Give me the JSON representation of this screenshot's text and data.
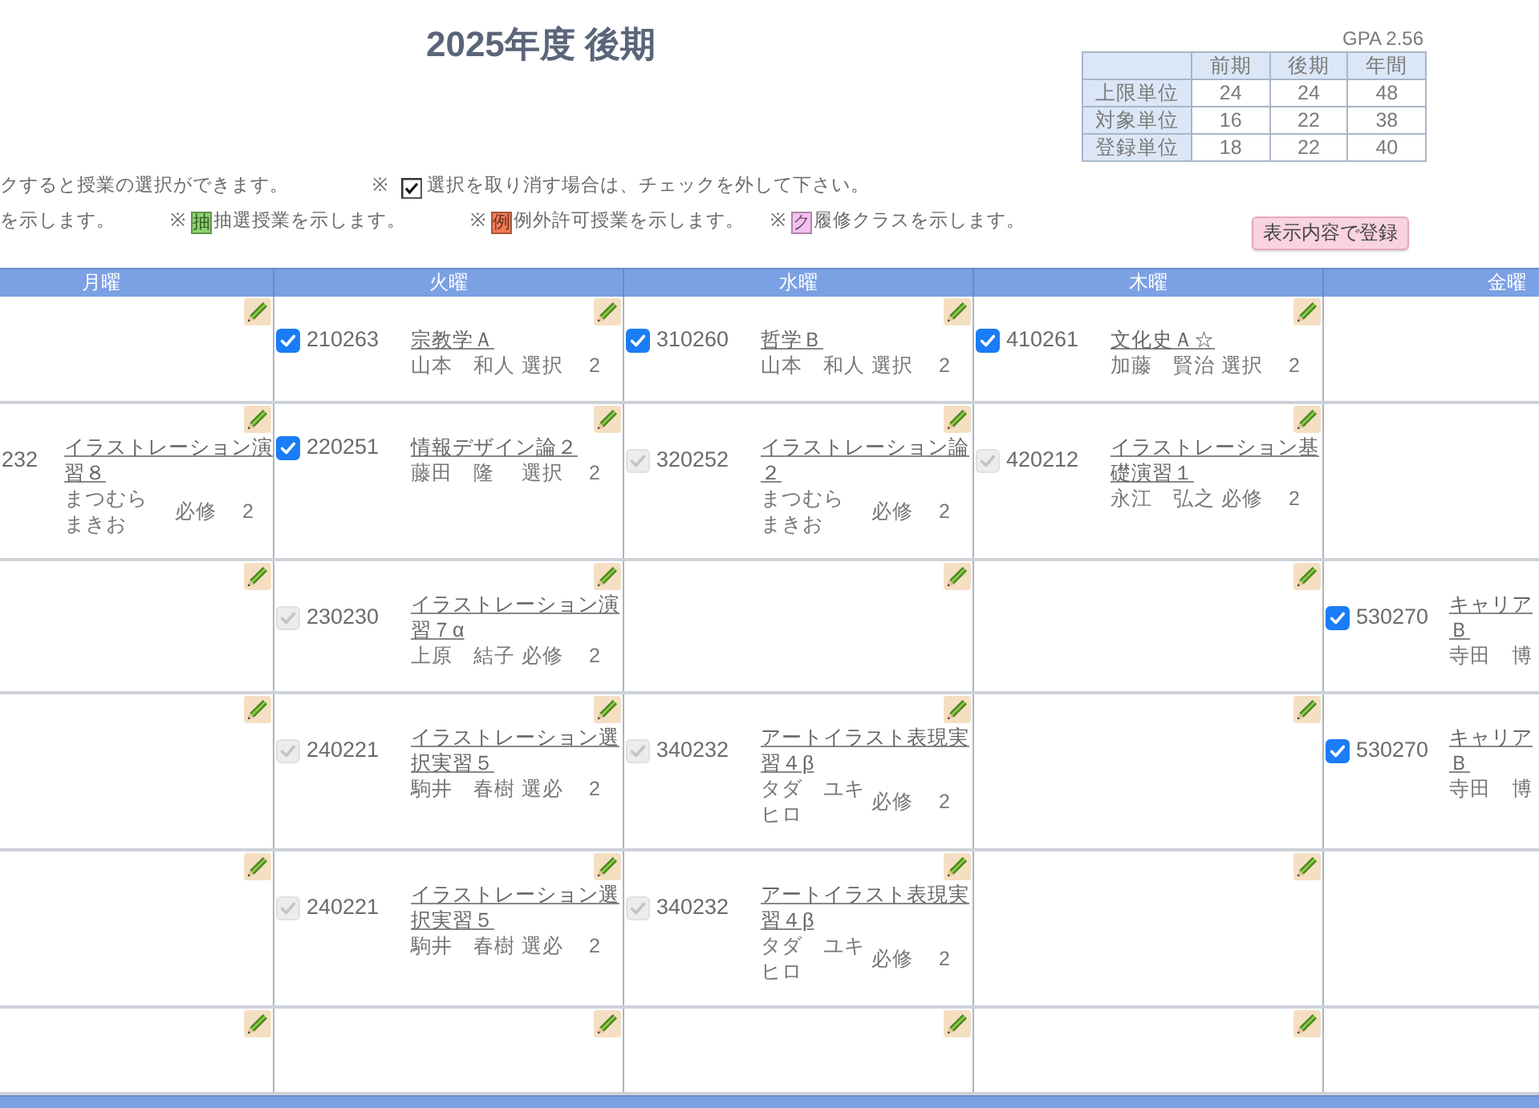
{
  "header": {
    "title": "2025年度 後期",
    "gpa": "GPA 2.56"
  },
  "credits_table": {
    "columns": [
      "前期",
      "後期",
      "年間"
    ],
    "rows": [
      {
        "label": "上限単位",
        "values": [
          "24",
          "24",
          "48"
        ]
      },
      {
        "label": "対象単位",
        "values": [
          "16",
          "22",
          "38"
        ]
      },
      {
        "label": "登録単位",
        "values": [
          "18",
          "22",
          "40"
        ]
      }
    ]
  },
  "legend": [
    {
      "items": [
        {
          "kind": "text",
          "text": "クすると授業の選択ができます。"
        },
        {
          "kind": "checkbox",
          "mark": "※",
          "checked": true,
          "text": "選択を取り消す場合は、チェックを外して下さい。"
        }
      ]
    },
    {
      "items": [
        {
          "kind": "text",
          "text": "を示します。"
        },
        {
          "kind": "tag",
          "mark": "※",
          "tag": "抽",
          "color": "#8cd46c",
          "text": "抽選授業を示します。"
        },
        {
          "kind": "tag",
          "mark": "※",
          "tag": "例",
          "color": "#f27b55",
          "text": "例外許可授業を示します。"
        },
        {
          "kind": "tag",
          "mark": "※",
          "tag": "ク",
          "color": "#f6bff2",
          "text": "履修クラスを示します。"
        }
      ]
    }
  ],
  "register_button": "表示内容で登録",
  "timetable": {
    "days": [
      "月曜",
      "火曜",
      "水曜",
      "木曜",
      "金曜"
    ],
    "rows": [
      {
        "cells": [
          {
            "editable": true
          },
          {
            "editable": true,
            "course": {
              "code": "210263",
              "title": "宗教学Ａ",
              "teacher": [
                "山本　和人"
              ],
              "category": "選択",
              "credits": "2",
              "checked": true,
              "disabled": false
            }
          },
          {
            "editable": true,
            "course": {
              "code": "310260",
              "title": "哲学Ｂ",
              "teacher": [
                "山本　和人"
              ],
              "category": "選択",
              "credits": "2",
              "checked": true,
              "disabled": false
            }
          },
          {
            "editable": true,
            "course": {
              "code": "410261",
              "title": "文化史Ａ☆",
              "teacher": [
                "加藤　賢治"
              ],
              "category": "選択",
              "credits": "2",
              "checked": true,
              "disabled": false
            }
          },
          {}
        ]
      },
      {
        "cells": [
          {
            "editable": true,
            "course": {
              "code": "232",
              "title": "イラストレーション演習８",
              "teacher": [
                "まつむら",
                "まきお"
              ],
              "category": "必修",
              "credits": "2"
            }
          },
          {
            "editable": true,
            "course": {
              "code": "220251",
              "title": "情報デザイン論２",
              "teacher": [
                "藤田　隆"
              ],
              "category": "選択",
              "credits": "2",
              "checked": true,
              "disabled": false
            }
          },
          {
            "editable": true,
            "course": {
              "code": "320252",
              "title": "イラストレーション論２",
              "teacher": [
                "まつむら",
                "まきお"
              ],
              "category": "必修",
              "credits": "2",
              "checked": true,
              "disabled": true
            }
          },
          {
            "editable": true,
            "course": {
              "code": "420212",
              "title": "イラストレーション基礎演習１",
              "teacher": [
                "永江　弘之"
              ],
              "category": "必修",
              "credits": "2",
              "checked": true,
              "disabled": true
            }
          },
          {}
        ]
      },
      {
        "cells": [
          {
            "editable": true
          },
          {
            "editable": true,
            "course": {
              "code": "230230",
              "title": "イラストレーション演習７α",
              "teacher": [
                "上原　結子"
              ],
              "category": "必修",
              "credits": "2",
              "checked": true,
              "disabled": true
            }
          },
          {
            "editable": true
          },
          {
            "editable": true
          },
          {
            "course": {
              "code": "530270",
              "title": "キャリアＢ",
              "teacher": [
                "寺田　博"
              ],
              "checked": true,
              "disabled": false
            }
          }
        ]
      },
      {
        "cells": [
          {
            "editable": true
          },
          {
            "editable": true,
            "course": {
              "code": "240221",
              "title": "イラストレーション選択実習５",
              "teacher": [
                "駒井　春樹"
              ],
              "category": "選必",
              "credits": "2",
              "checked": true,
              "disabled": true
            }
          },
          {
            "editable": true,
            "course": {
              "code": "340232",
              "title": "アートイラスト表現実習４β",
              "teacher": [
                "タダ　ユキヒロ"
              ],
              "category": "必修",
              "credits": "2",
              "checked": true,
              "disabled": true
            }
          },
          {
            "editable": true
          },
          {
            "course": {
              "code": "530270",
              "title": "キャリアＢ",
              "teacher": [
                "寺田　博"
              ],
              "checked": true,
              "disabled": false
            }
          }
        ]
      },
      {
        "cells": [
          {
            "editable": true
          },
          {
            "editable": true,
            "course": {
              "code": "240221",
              "title": "イラストレーション選択実習５",
              "teacher": [
                "駒井　春樹"
              ],
              "category": "選必",
              "credits": "2",
              "checked": true,
              "disabled": true
            }
          },
          {
            "editable": true,
            "course": {
              "code": "340232",
              "title": "アートイラスト表現実習４β",
              "teacher": [
                "タダ　ユキヒロ"
              ],
              "category": "必修",
              "credits": "2",
              "checked": true,
              "disabled": true
            }
          },
          {
            "editable": true
          },
          {}
        ]
      },
      {
        "cells": [
          {
            "editable": true
          },
          {
            "editable": true
          },
          {
            "editable": true
          },
          {
            "editable": true
          },
          {}
        ]
      }
    ]
  }
}
